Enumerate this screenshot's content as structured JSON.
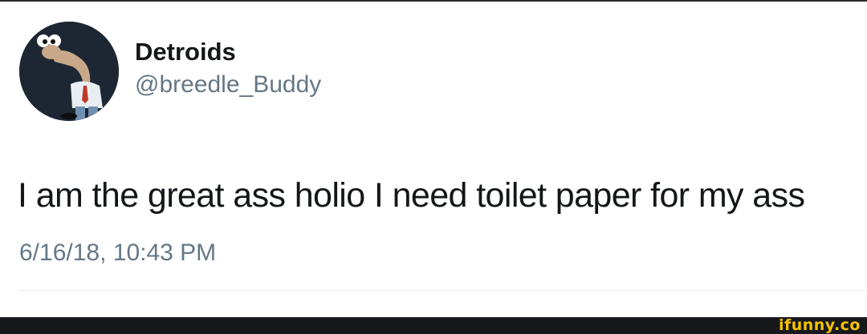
{
  "tweet": {
    "display_name": "Detroids",
    "handle": "@breedle_Buddy",
    "text": "I am the great ass holio I need toilet paper for my ass",
    "timestamp": "6/16/18, 10:43 PM",
    "avatar_icon": "cartoon-character-avatar"
  },
  "footer": {
    "watermark": "ifunny.co"
  },
  "colors": {
    "name": "#14171a",
    "secondary_text": "#657786",
    "divider": "#e6ecf0",
    "footer_bg": "#17181c",
    "watermark": "#f5c400"
  }
}
